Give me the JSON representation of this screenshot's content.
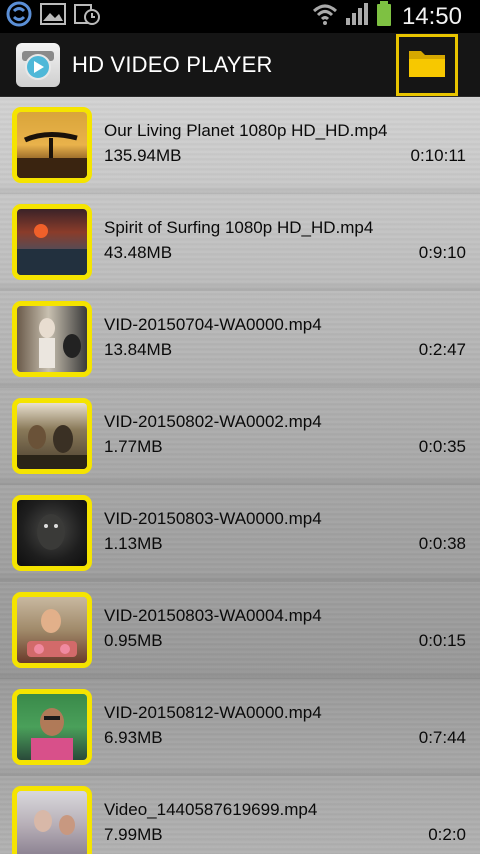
{
  "status_bar": {
    "time": "14:50",
    "icons": [
      "sync-icon",
      "image-icon",
      "calendar-clock-icon",
      "wifi-icon",
      "signal-icon",
      "battery-icon"
    ],
    "battery_color": "#7ec142"
  },
  "app_bar": {
    "title": "HD VIDEO PLAYER",
    "logo_icon": "player-logo-icon",
    "folder_icon": "folder-icon",
    "accent_color": "#e8c400"
  },
  "videos": [
    {
      "name": "Our Living Planet 1080p HD_HD.mp4",
      "size": "135.94MB",
      "duration": "0:10:11"
    },
    {
      "name": "Spirit of Surfing 1080p HD_HD.mp4",
      "size": "43.48MB",
      "duration": "0:9:10"
    },
    {
      "name": "VID-20150704-WA0000.mp4",
      "size": "13.84MB",
      "duration": "0:2:47"
    },
    {
      "name": "VID-20150802-WA0002.mp4",
      "size": "1.77MB",
      "duration": "0:0:35"
    },
    {
      "name": "VID-20150803-WA0000.mp4",
      "size": "1.13MB",
      "duration": "0:0:38"
    },
    {
      "name": "VID-20150803-WA0004.mp4",
      "size": "0.95MB",
      "duration": "0:0:15"
    },
    {
      "name": "VID-20150812-WA0000.mp4",
      "size": "6.93MB",
      "duration": "0:7:44"
    },
    {
      "name": "Video_1440587619699.mp4",
      "size": "7.99MB",
      "duration": "0:2:0"
    }
  ],
  "thumb_border_color": "#f5e400"
}
